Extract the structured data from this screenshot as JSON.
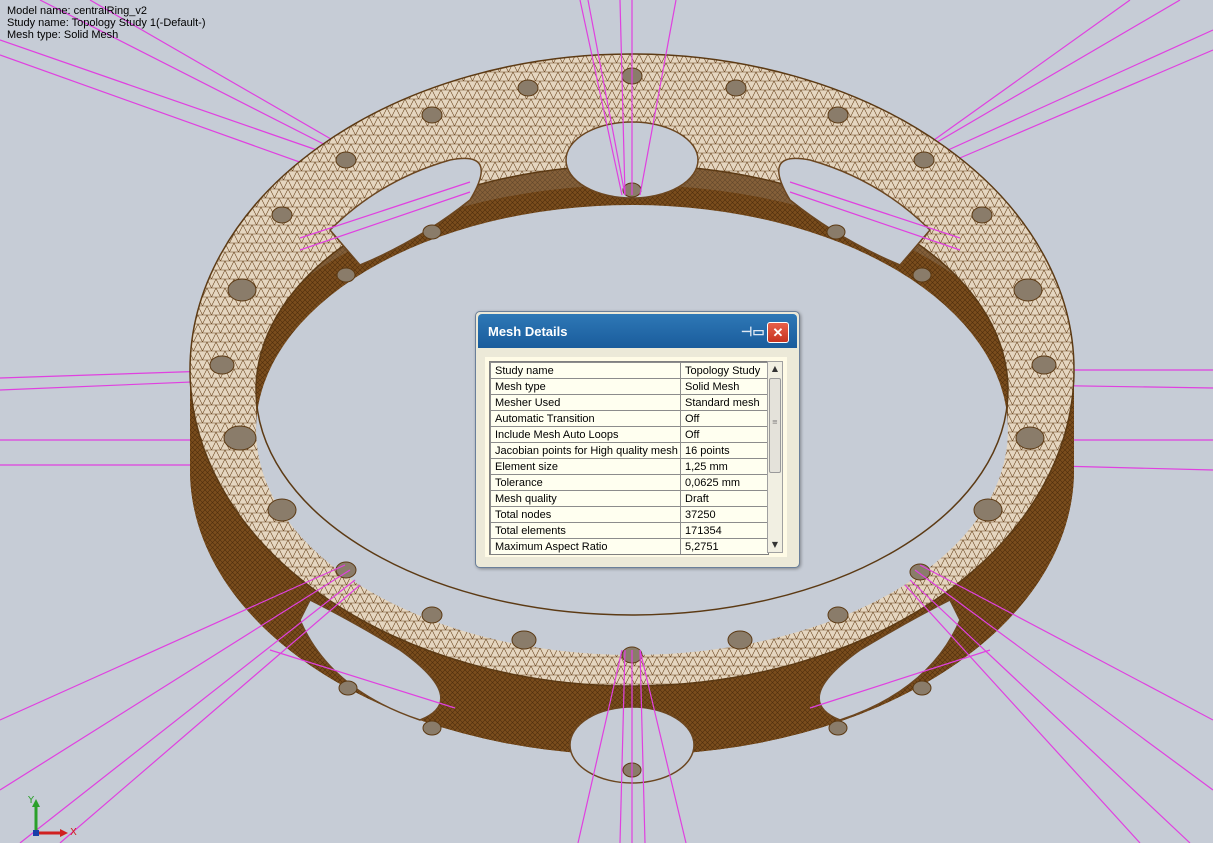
{
  "overlay": {
    "model_name": "Model name: centralRing_v2",
    "study_name": "Study name: Topology Study 1(-Default-)",
    "mesh_type": "Mesh type: Solid Mesh"
  },
  "triad": {
    "x_label": "X",
    "y_label": "Y"
  },
  "dialog": {
    "title": "Mesh Details",
    "pin_icon": "pin-icon",
    "close_icon": "close-icon",
    "rows": [
      {
        "key": "Study name",
        "value": "Topology Study"
      },
      {
        "key": "Mesh type",
        "value": "Solid Mesh"
      },
      {
        "key": "Mesher Used",
        "value": "Standard mesh"
      },
      {
        "key": "Automatic Transition",
        "value": "Off"
      },
      {
        "key": "Include Mesh Auto Loops",
        "value": "Off"
      },
      {
        "key": "Jacobian points for High quality mesh",
        "value": "16 points"
      },
      {
        "key": "Element size",
        "value": "1,25 mm"
      },
      {
        "key": "Tolerance",
        "value": "0,0625 mm"
      },
      {
        "key": "Mesh quality",
        "value": "Draft"
      },
      {
        "key": "Total nodes",
        "value": "37250"
      },
      {
        "key": "Total elements",
        "value": "171354"
      },
      {
        "key": "Maximum Aspect Ratio",
        "value": "5,2751"
      }
    ]
  },
  "colors": {
    "background": "#c6ccd6",
    "mesh_fill": "#e3d3bc",
    "mesh_edges": "#5c3a14",
    "wall": "#6e4418",
    "load_lines": "#e040e0",
    "dialog_title": "#1f64a6"
  }
}
